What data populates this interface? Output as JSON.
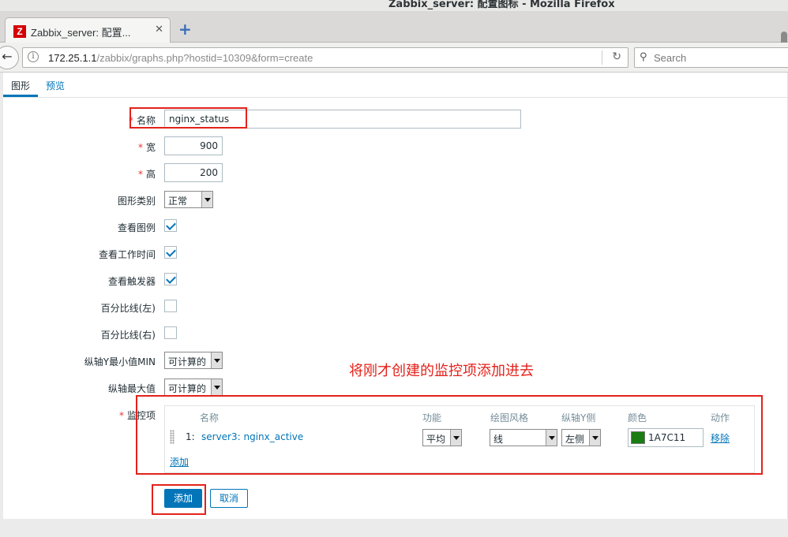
{
  "window": {
    "title": "Zabbix_server: 配置图标 - Mozilla Firefox"
  },
  "browser": {
    "tab_title": "Zabbix_server: 配置...",
    "tab_icon": "Z",
    "url_host": "172.25.1.1",
    "url_path": "/zabbix/graphs.php?hostid=10309&form=create",
    "search_placeholder": "Search"
  },
  "subtabs": {
    "graph": "图形",
    "preview": "预览"
  },
  "form": {
    "name_label": "名称",
    "name_value": "nginx_status",
    "width_label": "宽",
    "width_value": "900",
    "height_label": "高",
    "height_value": "200",
    "graph_type_label": "图形类别",
    "graph_type_value": "正常",
    "show_legend_label": "查看图例",
    "show_legend_checked": true,
    "show_working_time_label": "查看工作时间",
    "show_working_time_checked": true,
    "show_triggers_label": "查看触发器",
    "show_triggers_checked": true,
    "percentile_left_label": "百分比线(左)",
    "percentile_left_checked": false,
    "percentile_right_label": "百分比线(右)",
    "percentile_right_checked": false,
    "ymin_label": "纵轴Y最小值MIN",
    "ymin_value": "可计算的",
    "ymax_label": "纵轴最大值",
    "ymax_value": "可计算的",
    "items_label": "监控项"
  },
  "items_table": {
    "headers": {
      "name": "名称",
      "function": "功能",
      "draw_style": "绘图风格",
      "y_axis": "纵轴Y侧",
      "color": "颜色",
      "action": "动作"
    },
    "rows": [
      {
        "index": "1:",
        "name": "server3: nginx_active",
        "function": "平均",
        "draw_style": "线",
        "y_axis": "左侧",
        "color_hex": "1A7C11",
        "color": "#1a7c11",
        "remove": "移除"
      }
    ],
    "add_link": "添加"
  },
  "buttons": {
    "add": "添加",
    "cancel": "取消"
  },
  "annotation": "将刚才创建的监控项添加进去",
  "colors": {
    "accent": "#0275b8",
    "annotation_red": "#e3221b"
  }
}
